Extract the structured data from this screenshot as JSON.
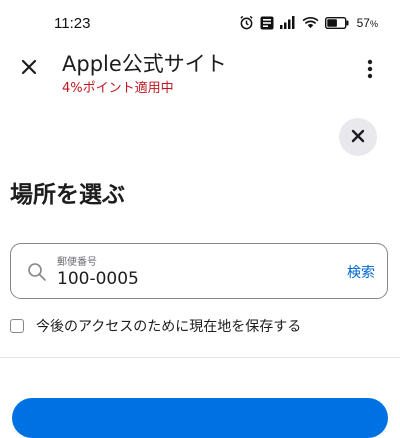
{
  "status_bar": {
    "time": "11:23",
    "battery_percent": "57",
    "battery_unit": "%",
    "battery_level": 0.57,
    "icons": [
      "alarm-icon",
      "volte-icon",
      "signal-icon",
      "wifi-icon",
      "battery-icon"
    ]
  },
  "app_bar": {
    "title": "Apple公式サイト",
    "subtitle": "4%ポイント適用中",
    "close_icon": "close-icon",
    "more_icon": "more-vertical-icon"
  },
  "location_picker": {
    "dismiss_icon": "close-icon",
    "title": "場所を選ぶ",
    "postal_field": {
      "label": "郵便番号",
      "value": "100-0005",
      "icon": "search-icon"
    },
    "search_label": "検索",
    "save_location_label": "今後のアクセスのために現在地を保存する",
    "save_location_checked": false
  },
  "colors": {
    "subtitle": "#c0171f",
    "link": "#0066cc",
    "primary_button": "#0071e3",
    "dismiss_bg": "#e8e8ed"
  }
}
